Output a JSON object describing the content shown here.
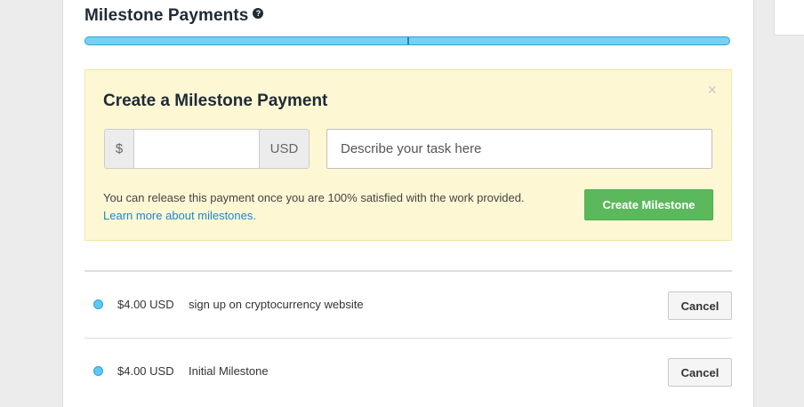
{
  "header": {
    "title": "Milestone Payments",
    "help_icon": "question-circle-icon"
  },
  "progress": {
    "fraction_marker": 0.5,
    "fill_color": "#75d1f7"
  },
  "create_panel": {
    "title": "Create a Milestone Payment",
    "close_symbol": "×",
    "currency_symbol": "$",
    "currency_code": "USD",
    "amount_value": "",
    "task_placeholder": "Describe your task here",
    "info_text": "You can release this payment once you are 100% satisfied with the work provided.",
    "learn_more": "Learn more about milestones.",
    "create_button": "Create Milestone",
    "background_color": "#fdf7d4",
    "button_color": "#5cb85c"
  },
  "milestones": [
    {
      "amount": "$4.00 USD",
      "description": "sign up on cryptocurrency website",
      "cancel_label": "Cancel"
    },
    {
      "amount": "$4.00 USD",
      "description": "Initial Milestone",
      "cancel_label": "Cancel"
    }
  ]
}
